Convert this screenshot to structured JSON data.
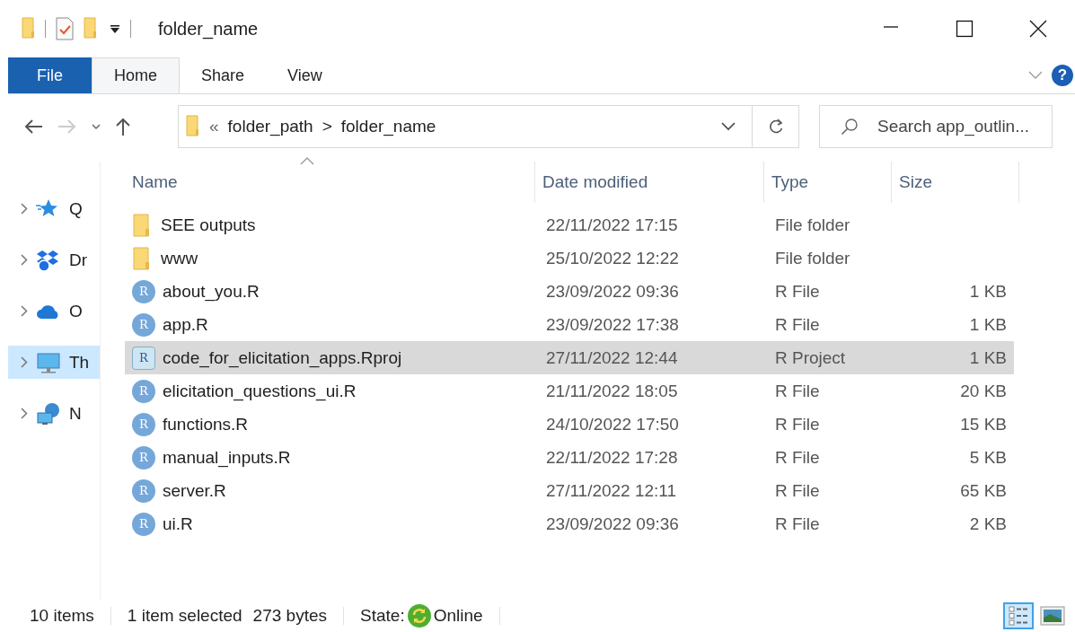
{
  "window": {
    "title": "folder_name"
  },
  "ribbon": {
    "tabs": [
      {
        "label": "File",
        "kind": "file",
        "selected": false
      },
      {
        "label": "Home",
        "kind": "tab",
        "selected": true
      },
      {
        "label": "Share",
        "kind": "tab",
        "selected": false
      },
      {
        "label": "View",
        "kind": "tab",
        "selected": false
      }
    ],
    "help": "?"
  },
  "address_bar": {
    "prefix": "«",
    "path": [
      {
        "label": "folder_path"
      },
      {
        "label": "folder_name"
      }
    ],
    "separator": ">"
  },
  "search": {
    "placeholder": "Search app_outlin..."
  },
  "navigation": [
    {
      "label": "Q",
      "kind": "star",
      "selected": false
    },
    {
      "label": "Dr",
      "kind": "dropbox",
      "selected": false
    },
    {
      "label": "O",
      "kind": "cloud",
      "selected": false
    },
    {
      "label": "Th",
      "kind": "pc",
      "selected": true
    },
    {
      "label": "N",
      "kind": "network",
      "selected": false
    }
  ],
  "table": {
    "columns": [
      "Name",
      "Date modified",
      "Type",
      "Size"
    ],
    "rows": [
      {
        "name": "SEE outputs",
        "kind": "folder",
        "date": "22/11/2022 17:15",
        "type": "File folder",
        "size": "",
        "selected": false
      },
      {
        "name": "www",
        "kind": "folder",
        "date": "25/10/2022 12:22",
        "type": "File folder",
        "size": "",
        "selected": false
      },
      {
        "name": "about_you.R",
        "kind": "r",
        "badge": "R",
        "date": "23/09/2022 09:36",
        "type": "R File",
        "size": "1 KB",
        "selected": false
      },
      {
        "name": "app.R",
        "kind": "r",
        "badge": "R",
        "date": "23/09/2022 17:38",
        "type": "R File",
        "size": "1 KB",
        "selected": false
      },
      {
        "name": "code_for_elicitation_apps.Rproj",
        "kind": "rproj",
        "badge": "R",
        "date": "27/11/2022 12:44",
        "type": "R Project",
        "size": "1 KB",
        "selected": true
      },
      {
        "name": "elicitation_questions_ui.R",
        "kind": "r",
        "badge": "R",
        "date": "21/11/2022 18:05",
        "type": "R File",
        "size": "20 KB",
        "selected": false
      },
      {
        "name": "functions.R",
        "kind": "r",
        "badge": "R",
        "date": "24/10/2022 17:50",
        "type": "R File",
        "size": "15 KB",
        "selected": false
      },
      {
        "name": "manual_inputs.R",
        "kind": "r",
        "badge": "R",
        "date": "22/11/2022 17:28",
        "type": "R File",
        "size": "5 KB",
        "selected": false
      },
      {
        "name": "server.R",
        "kind": "r",
        "badge": "R",
        "date": "27/11/2022 12:11",
        "type": "R File",
        "size": "65 KB",
        "selected": false
      },
      {
        "name": "ui.R",
        "kind": "r",
        "badge": "R",
        "date": "23/09/2022 09:36",
        "type": "R File",
        "size": "2 KB",
        "selected": false
      }
    ]
  },
  "status_bar": {
    "count": "10 items",
    "selection": "1 item selected",
    "size": "273 bytes",
    "state_label": "State:",
    "state": "Online"
  }
}
